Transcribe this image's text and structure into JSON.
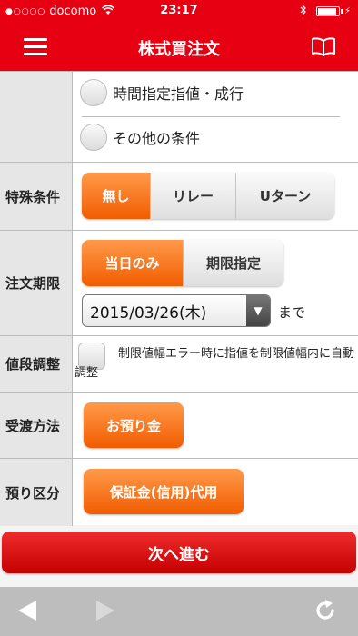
{
  "status_bar": {
    "carrier_dots": "●○○○○",
    "carrier": "docomo",
    "time": "23:17"
  },
  "nav": {
    "title": "株式買注文"
  },
  "conditions": {
    "options": [
      {
        "label": "時間指定指値・成行"
      },
      {
        "label": "その他の条件"
      }
    ]
  },
  "special": {
    "label": "特殊条件",
    "buttons": [
      {
        "label": "無し",
        "active": true
      },
      {
        "label": "リレー",
        "active": false
      },
      {
        "label": "Uターン",
        "active": false
      }
    ]
  },
  "period": {
    "label": "注文期限",
    "buttons": [
      {
        "label": "当日のみ",
        "active": true
      },
      {
        "label": "期限指定",
        "active": false
      }
    ],
    "date": "2015/03/26(木)",
    "until": "まで"
  },
  "price_adjust": {
    "label": "値段調整",
    "text": "制限値幅エラー時に指値を制限値幅内に自動調整"
  },
  "delivery": {
    "label": "受渡方法",
    "button": "お預り金"
  },
  "deposit": {
    "label": "預り区分",
    "button": "保証金(信用)代用"
  },
  "next_button": "次へ進む",
  "colors": {
    "brand_red": "#e60012",
    "active_orange": "#f25c00"
  }
}
